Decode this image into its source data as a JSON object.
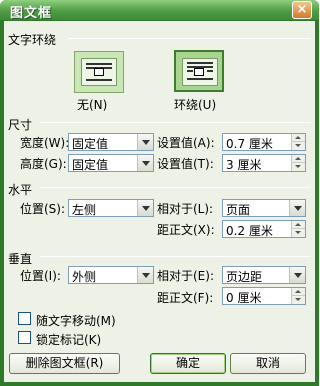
{
  "window": {
    "title": "图文框",
    "close_label": "×"
  },
  "wrap": {
    "section_title": "文字环绕",
    "options": [
      {
        "label": "无(N)",
        "selected": false
      },
      {
        "label": "环绕(U)",
        "selected": true
      }
    ]
  },
  "size": {
    "section_title": "尺寸",
    "width_label": "宽度(W):",
    "width_mode": "固定值",
    "width_set_label": "设置值(A):",
    "width_value": "0.7 厘米",
    "height_label": "高度(G):",
    "height_mode": "固定值",
    "height_set_label": "设置值(T):",
    "height_value": "3 厘米"
  },
  "horizontal": {
    "section_title": "水平",
    "position_label": "位置(S):",
    "position_value": "左侧",
    "relative_label": "相对于(L):",
    "relative_value": "页面",
    "distance_label": "距正文(X):",
    "distance_value": "0.2 厘米"
  },
  "vertical": {
    "section_title": "垂直",
    "position_label": "位置(I):",
    "position_value": "外侧",
    "relative_label": "相对于(E):",
    "relative_value": "页边距",
    "distance_label": "距正文(F):",
    "distance_value": "0 厘米"
  },
  "options": {
    "move_with_text": "随文字移动(M)",
    "lock_anchor": "锁定标记(K)"
  },
  "buttons": {
    "delete": "删除图文框(R)",
    "ok": "确定",
    "cancel": "取消"
  }
}
